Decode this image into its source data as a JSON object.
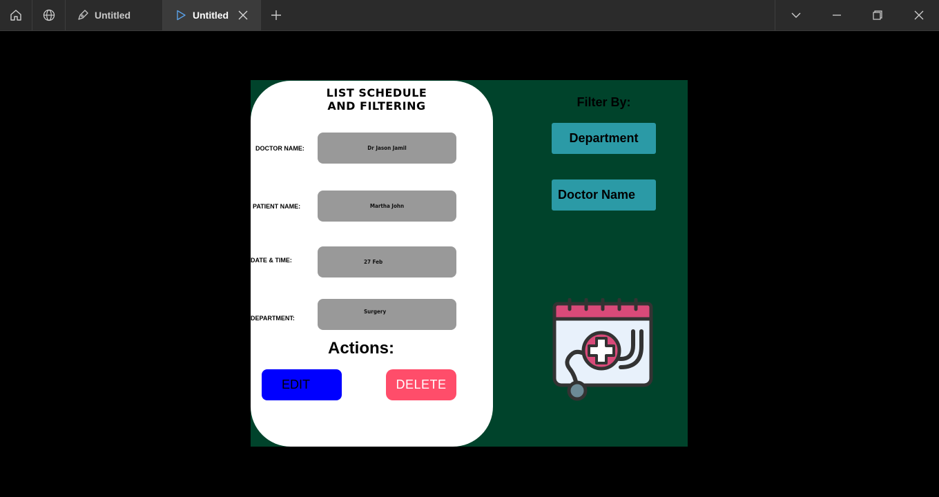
{
  "window": {
    "tabs": [
      {
        "label": "Untitled",
        "active": false
      },
      {
        "label": "Untitled",
        "active": true
      }
    ]
  },
  "card": {
    "title": "LIST SCHEDULE\nAND FILTERING",
    "fields": [
      {
        "label": "DOCTOR NAME:",
        "value": "Dr Jason Jamil"
      },
      {
        "label": "PATIENT NAME:",
        "value": "Martha John"
      },
      {
        "label": "DATE & TIME:",
        "value": "27 Feb"
      },
      {
        "label": "DEPARTMENT:",
        "value": "Surgery"
      }
    ],
    "actions_title": "Actions:",
    "edit_label": "EDIT",
    "delete_label": "DELETE"
  },
  "filter": {
    "title": "Filter By:",
    "department_label": "Department",
    "doctor_label": "Doctor Name"
  },
  "colors": {
    "canvas_bg": "#00432b",
    "field_bg": "#999999",
    "edit_bg": "#0000ff",
    "delete_bg": "#ff4d6a",
    "filter_bg": "#2b9aa6",
    "calendar_accent": "#e04f7e"
  },
  "icons": [
    "home-icon",
    "globe-icon",
    "pen-icon",
    "play-icon",
    "close-icon",
    "plus-icon",
    "chevron-down-icon",
    "minimize-icon",
    "restore-icon",
    "window-close-icon",
    "medical-calendar-icon"
  ]
}
